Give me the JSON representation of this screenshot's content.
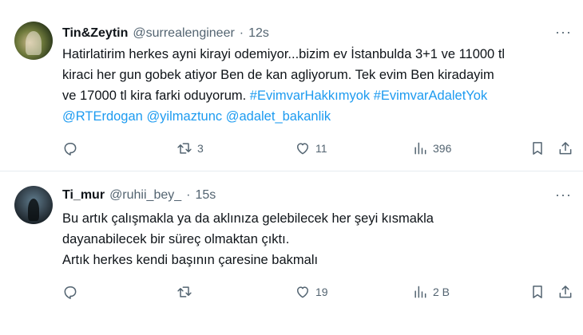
{
  "tweets": [
    {
      "display_name": "Tin&Zeytin",
      "handle": "@surrealengineer",
      "separator": "·",
      "time": "12s",
      "more": "···",
      "lines": [
        [
          {
            "t": "Hatirlatirim herkes ayni kirayi odemiyor...bizim ev İstanbulda 3+1 ve 11000 tl"
          }
        ],
        [
          {
            "t": "kiraci her gun gobek atiyor Ben de kan agliyorum. Tek evim Ben  kiradayim"
          }
        ],
        [
          {
            "t": "ve 17000 tl kira farki oduyorum. "
          },
          {
            "t": "#EvimvarHakkımyok",
            "link": true
          },
          {
            "t": " "
          },
          {
            "t": "#EvimvarAdaletYok",
            "link": true
          }
        ],
        [
          {
            "t": "@RTErdogan",
            "link": true
          },
          {
            "t": " "
          },
          {
            "t": "@yilmaztunc",
            "link": true
          },
          {
            "t": " "
          },
          {
            "t": "@adalet_bakanlik",
            "link": true
          }
        ]
      ],
      "reply_count": "",
      "retweet_count": "3",
      "like_count": "11",
      "view_count": "396"
    },
    {
      "display_name": "Ti_mur",
      "handle": "@ruhii_bey_",
      "separator": "·",
      "time": "15s",
      "more": "···",
      "lines": [
        [
          {
            "t": "Bu artık  çalışmakla ya da aklınıza gelebilecek her şeyi kısmakla"
          }
        ],
        [
          {
            "t": "dayanabilecek bir süreç olmaktan çıktı."
          }
        ],
        [
          {
            "t": "Artık herkes kendi başının çaresine bakmalı"
          }
        ]
      ],
      "reply_count": "",
      "retweet_count": "",
      "like_count": "19",
      "view_count": "2 B"
    }
  ],
  "icons": {
    "reply": "reply-icon",
    "retweet": "retweet-icon",
    "like": "heart-icon",
    "views": "views-icon",
    "bookmark": "bookmark-icon",
    "share": "share-icon",
    "more": "more-icon"
  },
  "colors": {
    "link": "#1d9bf0",
    "secondary_text": "#536471",
    "primary_text": "#0f1419"
  }
}
